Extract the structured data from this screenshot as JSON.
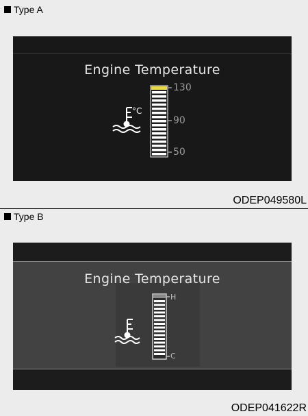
{
  "type_a": {
    "label": "Type A",
    "title": "Engine Temperature",
    "unit": "°C",
    "ticks": [
      "130",
      "90",
      "50"
    ],
    "code": "ODEP049580L",
    "highlight_color": "#e8d84a",
    "icon": "coolant-temperature-icon"
  },
  "type_b": {
    "label": "Type B",
    "title": "Engine Temperature",
    "ticks": [
      "H",
      "C"
    ],
    "code": "ODEP041622R",
    "icon": "coolant-temperature-icon"
  }
}
